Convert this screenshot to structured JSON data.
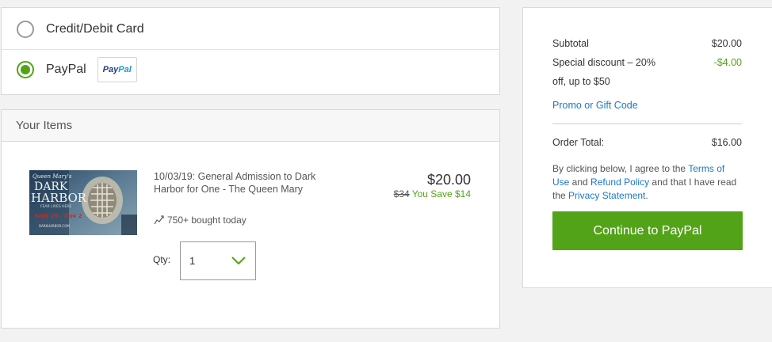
{
  "payment": {
    "options": [
      {
        "label": "Credit/Debit Card",
        "selected": false
      },
      {
        "label": "PayPal",
        "selected": true
      }
    ],
    "paypal_logo": {
      "part1": "Pay",
      "part2": "Pal"
    }
  },
  "items": {
    "header": "Your Items",
    "item": {
      "title": "10/03/19: General Admission to Dark Harbor for One - The Queen Mary",
      "price": "$20.00",
      "original_price": "$34",
      "savings": "You Save $14",
      "bought": "750+ bought today",
      "qty_label": "Qty:",
      "qty_value": "1",
      "image_text": {
        "brand": "Queen Mary's",
        "line1": "DARK",
        "line2": "HARBOR",
        "tagline": "FEAR LIVES HERE",
        "dates": "Sept 26 - Nov 2",
        "url": "DARKHARBOR.COM"
      }
    }
  },
  "summary": {
    "subtotal_label": "Subtotal",
    "subtotal_value": "$20.00",
    "discount_label_line1": "Special discount – 20%",
    "discount_label_line2": "off, up to $50",
    "discount_value": "-$4.00",
    "promo_link": "Promo or Gift Code",
    "total_label": "Order Total:",
    "total_value": "$16.00",
    "terms": {
      "prefix": "By clicking below, I agree to the ",
      "terms_link": "Terms of Use",
      "and": " and ",
      "refund_link": "Refund Policy",
      "middle": " and that I have read the ",
      "privacy_link": "Privacy Statement",
      "suffix": "."
    },
    "cta_label": "Continue to PayPal"
  },
  "colors": {
    "accent_green": "#53a318",
    "link_blue": "#1a77c9"
  }
}
